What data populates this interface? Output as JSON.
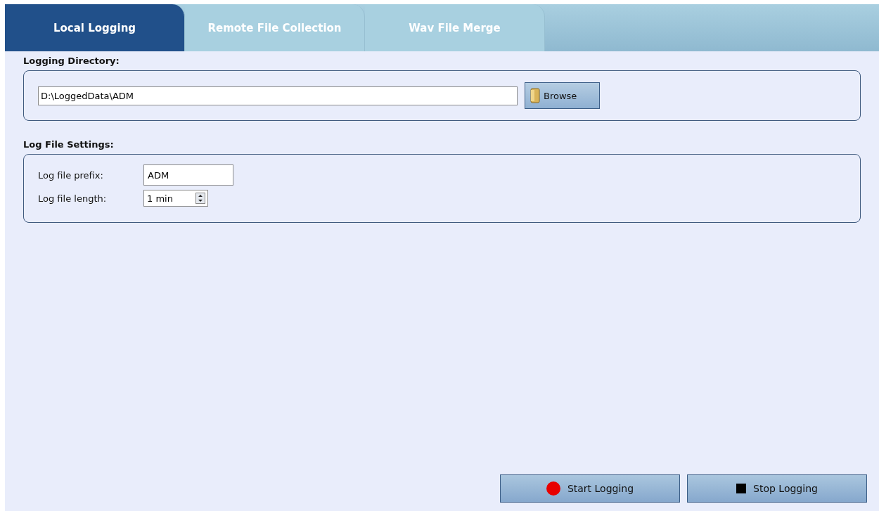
{
  "tabs": [
    {
      "label": "Local Logging",
      "selected": true
    },
    {
      "label": "Remote File Collection",
      "selected": false
    },
    {
      "label": "Wav File Merge",
      "selected": false
    }
  ],
  "logging_directory": {
    "title": "Logging Directory:",
    "path": "D:\\LoggedData\\ADM",
    "browse_button": "Browse"
  },
  "log_file_settings": {
    "title": "Log File Settings:",
    "fields": [
      {
        "label": "Log file prefix:",
        "value": "ADM",
        "kind": "text"
      },
      {
        "label": "Log file length:",
        "value": "1 min",
        "kind": "spinner"
      }
    ]
  },
  "actions": [
    {
      "label": "Start Logging",
      "kind": "start"
    },
    {
      "label": "Stop Logging",
      "kind": "stop"
    }
  ]
}
